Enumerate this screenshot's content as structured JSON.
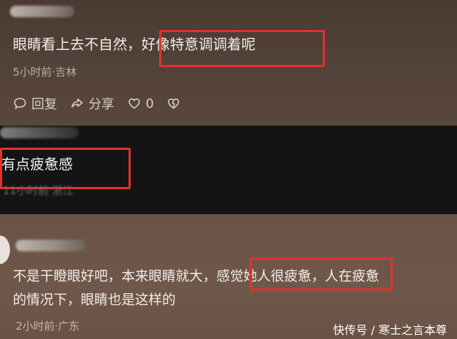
{
  "comment1": {
    "text_before": "眼睛看上去不自然，",
    "text_highlight": "好像特意调调着呢",
    "meta": "5小时前·吉林",
    "actions": {
      "reply": "回复",
      "share": "分享",
      "like_count": "0"
    }
  },
  "comment2": {
    "text": "有点疲惫感",
    "meta": "11小时前·浙江"
  },
  "comment3": {
    "line1_before": "不是干瞪眼好吧，本来眼睛就大，",
    "line1_highlight": "感觉她人很疲惫，",
    "line1_after": "人在疲惫",
    "line2": "的情况下，眼睛也是这样的",
    "meta": "2小时前·广东"
  },
  "watermark": "快传号 / 寒士之言本尊",
  "highlight_color": "#e3312e"
}
